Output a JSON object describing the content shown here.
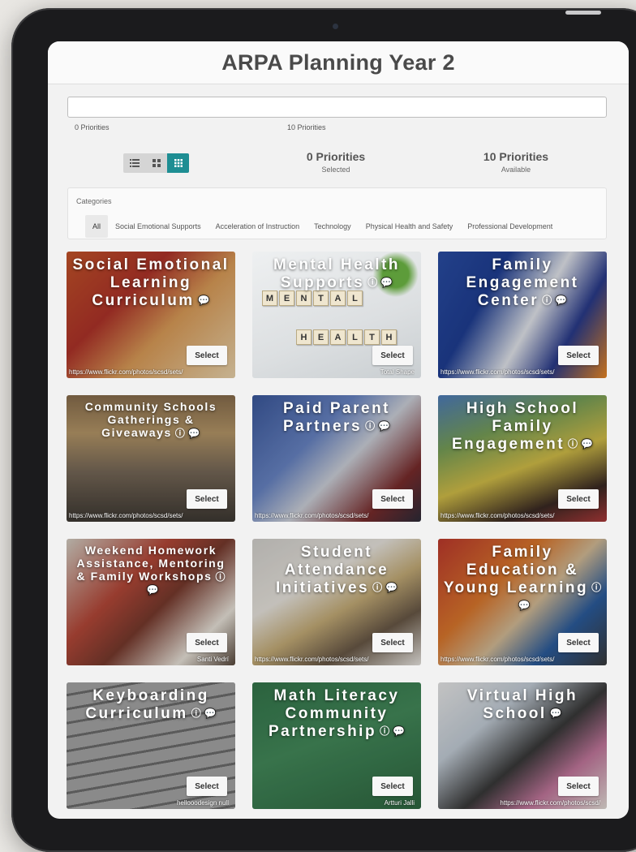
{
  "app": {
    "title": "ARPA Planning Year 2"
  },
  "progress": {
    "left_label": "0 Priorities",
    "right_label": "10 Priorities",
    "fill_fraction": 0
  },
  "view_toggle": {
    "options": [
      "list-view",
      "grid-view",
      "tile-view"
    ],
    "active": "tile-view"
  },
  "stats": {
    "selected_count": "0 Priorities",
    "selected_label": "Selected",
    "available_count": "10 Priorities",
    "available_label": "Available"
  },
  "categories": {
    "label": "Categories",
    "tabs": [
      "All",
      "Social Emotional Supports",
      "Acceleration of Instruction",
      "Technology",
      "Physical Health and Safety",
      "Professional Development"
    ],
    "active": "All"
  },
  "cards": [
    {
      "title": "Social Emotional Learning Curriculum",
      "credit": "https://www.flickr.com/photos/scsd/sets/",
      "select_label": "Select"
    },
    {
      "title": "Mental Health Supports",
      "credit": "Total Shape",
      "select_label": "Select",
      "tiles_top": "MENTAL",
      "tiles_bottom": "HEALTH"
    },
    {
      "title": "Family Engagement Center",
      "credit": "https://www.flickr.com/photos/scsd/sets/",
      "select_label": "Select"
    },
    {
      "title": "Community Schools Gatherings & Giveaways",
      "credit": "https://www.flickr.com/photos/scsd/sets/",
      "select_label": "Select"
    },
    {
      "title": "Paid Parent Partners",
      "credit": "https://www.flickr.com/photos/scsd/sets/",
      "select_label": "Select"
    },
    {
      "title": "High School Family Engagement",
      "credit": "https://www.flickr.com/photos/scsd/sets/",
      "select_label": "Select"
    },
    {
      "title": "Weekend Homework Assistance, Mentoring & Family Workshops",
      "credit": "Santi Vedrí",
      "select_label": "Select"
    },
    {
      "title": "Student Attendance Initiatives",
      "credit": "https://www.flickr.com/photos/scsd/sets/",
      "select_label": "Select"
    },
    {
      "title": "Family Education & Young Learning",
      "credit": "https://www.flickr.com/photos/scsd/sets/",
      "select_label": "Select"
    },
    {
      "title": "Keyboarding Curriculum",
      "credit": "hellooodesign null",
      "select_label": "Select"
    },
    {
      "title": "Math Literacy Community Partnership",
      "credit": "Artturi Jalli",
      "select_label": "Select"
    },
    {
      "title": "Virtual High School",
      "credit": "https://www.flickr.com/photos/scsd/",
      "select_label": "Select"
    }
  ],
  "card_icons": [
    "info-icon",
    "comment-icon"
  ],
  "colors": {
    "accent": "#1e8e93",
    "title_text": "#4a4a4a",
    "screen_bg": "#f2f2f2"
  }
}
